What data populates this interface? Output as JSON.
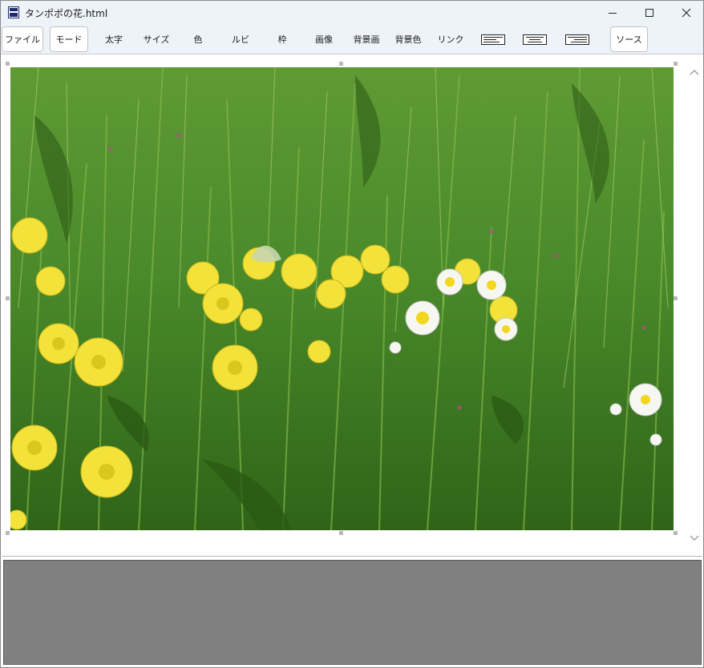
{
  "window": {
    "title": "タンポポの花.html",
    "app_icon": "floppy-disk-icon",
    "controls": {
      "minimize": "minimize-icon",
      "maximize": "maximize-icon",
      "close": "close-icon"
    }
  },
  "toolbar": {
    "file": "ファイル",
    "mode": "モード",
    "bold": "太字",
    "size": "サイズ",
    "color": "色",
    "ruby": "ルビ",
    "frame": "枠",
    "image": "画像",
    "bg_image": "背景画",
    "bg_color": "背景色",
    "link": "リンク",
    "align_left": "align-left-icon",
    "align_center": "align-center-icon",
    "align_right": "align-right-icon",
    "source": "ソース"
  },
  "content": {
    "image": "dandelion-field-photo",
    "scroll_up": "scroll-up-arrow-icon",
    "scroll_down": "scroll-down-arrow-icon"
  },
  "colors": {
    "title_bg": "#eef3f9",
    "panel_gray": "#808080",
    "grass_green": "#3f7a24",
    "dandelion_yellow": "#f2e23a"
  }
}
